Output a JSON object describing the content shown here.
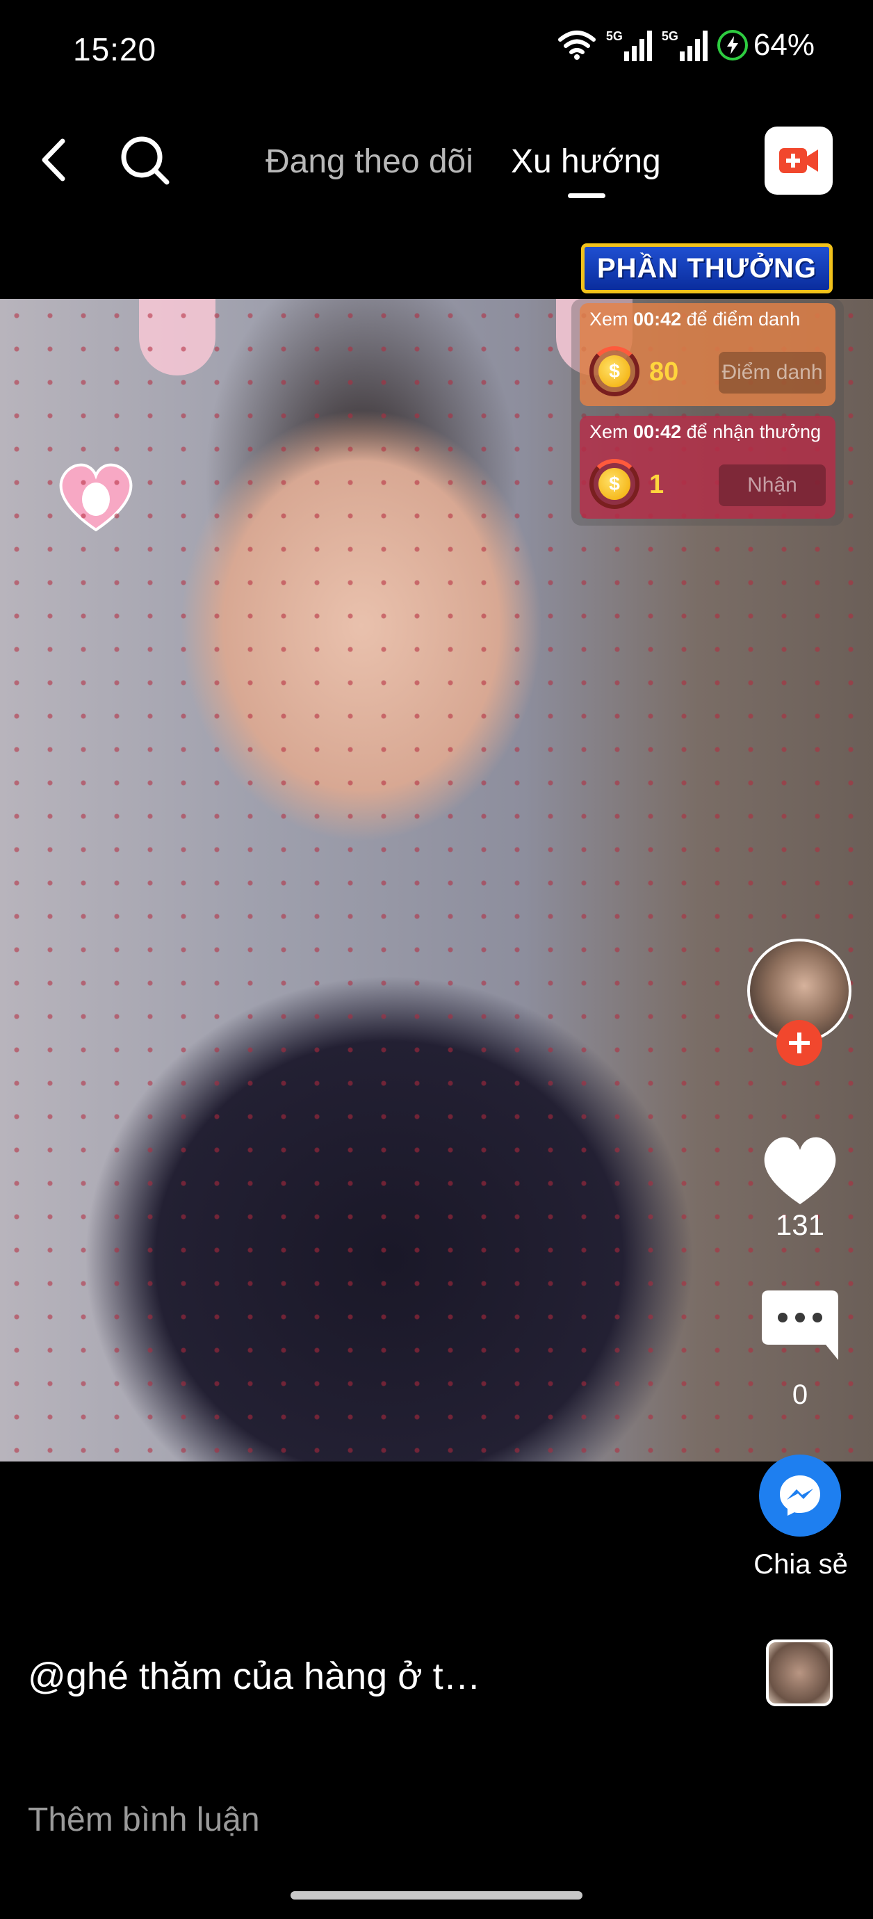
{
  "status_bar": {
    "time": "15:20",
    "network_1": "5G",
    "network_2": "5G",
    "battery": "64%",
    "icons": [
      "wifi-icon",
      "signal-icon",
      "signal-icon",
      "charging-icon"
    ]
  },
  "nav": {
    "tab_following": "Đang theo dõi",
    "tab_trending": "Xu hướng",
    "active_tab": "Xu hướng",
    "icons": [
      "back-icon",
      "search-icon",
      "live-video-icon"
    ]
  },
  "reward": {
    "header": "PHẦN THƯỞNG",
    "checkin": {
      "prefix": "Xem ",
      "time": "00:42",
      "suffix": " để điểm danh",
      "coins": "80",
      "button": "Điểm danh"
    },
    "claim": {
      "prefix": "Xem ",
      "time": "00:42",
      "suffix": " để nhận thưởng",
      "coins": "1",
      "button": "Nhận"
    },
    "colors": {
      "header_bg": "#1f4fd1",
      "header_border": "#f2c21b",
      "coin": "#ffd53d"
    }
  },
  "actions": {
    "likes": "131",
    "comments": "0",
    "share_label": "Chia sẻ",
    "colors": {
      "follow": "#f1472d",
      "share": "#1e7ff0"
    }
  },
  "caption": "@ghé thăm của hàng ở t…",
  "comment_placeholder": "Thêm bình luận"
}
